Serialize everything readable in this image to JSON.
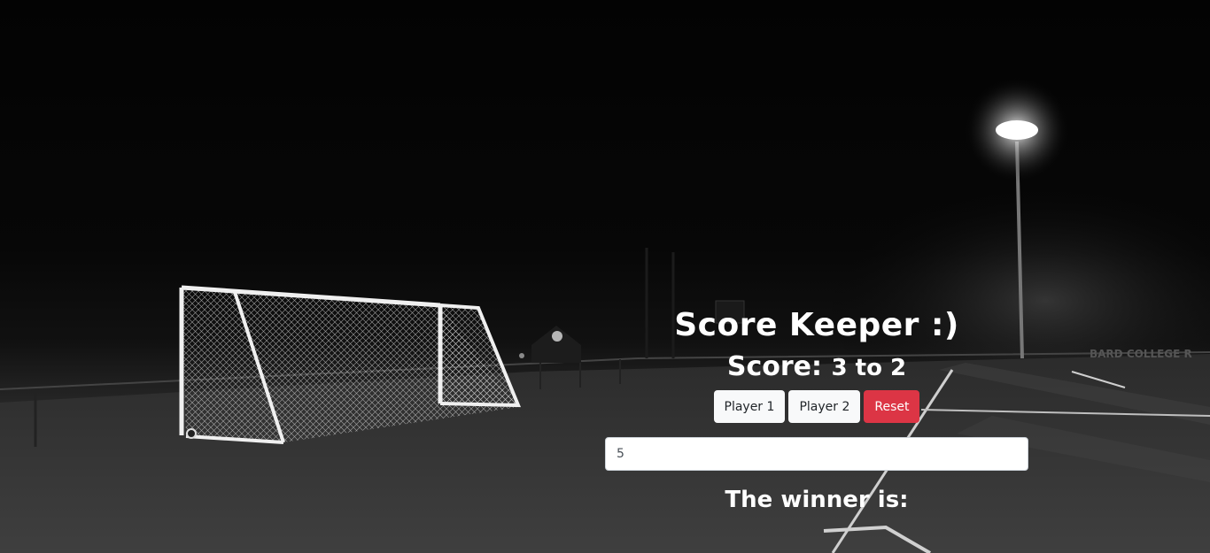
{
  "app": {
    "title": "Score Keeper :)",
    "score_label": "Score:",
    "player1_score": "3",
    "to_word": "to",
    "player2_score": "2"
  },
  "buttons": {
    "player1_label": "Player 1",
    "player2_label": "Player 2",
    "reset_label": "Reset"
  },
  "winning_score_input": {
    "value": "5"
  },
  "winner": {
    "label": "The winner is:"
  },
  "background": {
    "stadium_sign": "BARD COLLEGE R",
    "colors": {
      "button_light": "#f8f9fa",
      "button_danger": "#dc3545",
      "text": "#ffffff"
    }
  }
}
